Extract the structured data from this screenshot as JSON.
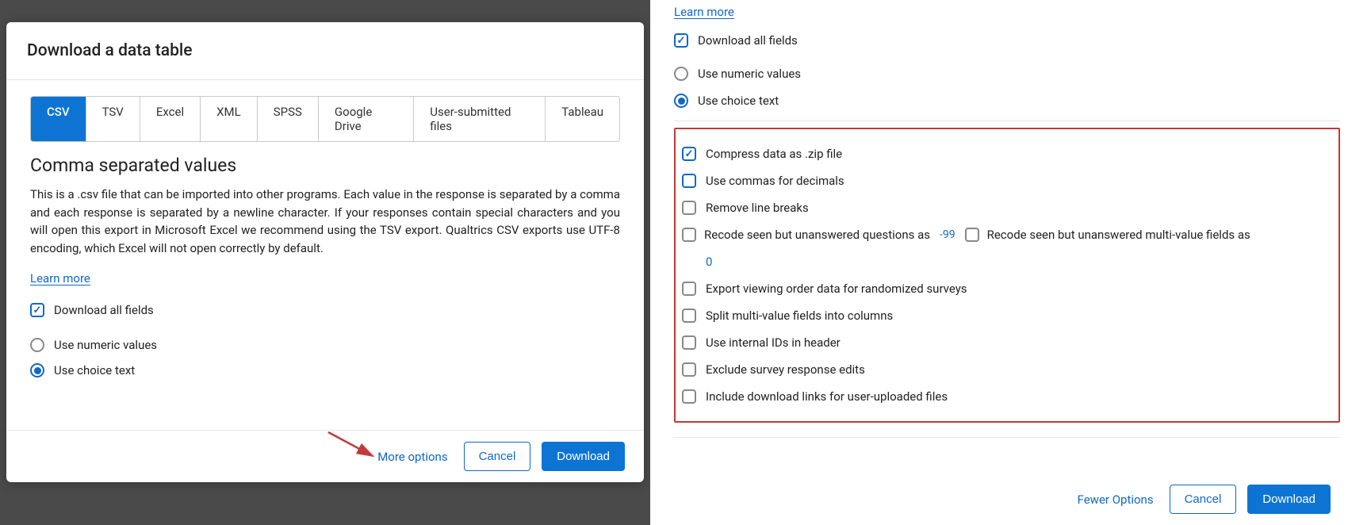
{
  "dialog": {
    "title": "Download a data table",
    "tabs": [
      "CSV",
      "TSV",
      "Excel",
      "XML",
      "SPSS",
      "Google Drive",
      "User-submitted files",
      "Tableau"
    ],
    "active_tab_index": 0,
    "subtitle": "Comma separated values",
    "description": "This is a .csv file that can be imported into other programs. Each value in the response is separated by a comma and each response is separated by a newline character. If your responses contain special characters and you will open this export in Microsoft Excel we recommend using the TSV export. Qualtrics CSV exports use UTF-8 encoding, which Excel will not open correctly by default.",
    "learn_more": "Learn more",
    "download_all_fields": "Download all fields",
    "use_numeric": "Use numeric values",
    "use_choice_text": "Use choice text",
    "footer": {
      "more_options": "More options",
      "cancel": "Cancel",
      "download": "Download"
    }
  },
  "right": {
    "learn_more": "Learn more",
    "download_all_fields": "Download all fields",
    "use_numeric": "Use numeric values",
    "use_choice_text": "Use choice text",
    "options": {
      "compress": "Compress data as .zip file",
      "commas_decimals": "Use commas for decimals",
      "remove_line_breaks": "Remove line breaks",
      "recode_q": "Recode seen but unanswered questions as",
      "recode_q_val": "-99",
      "recode_mv": "Recode seen but unanswered multi-value fields as",
      "recode_mv_val": "0",
      "export_order": "Export viewing order data for randomized surveys",
      "split_mv": "Split multi-value fields into columns",
      "internal_ids": "Use internal IDs in header",
      "exclude_edits": "Exclude survey response edits",
      "include_links": "Include download links for user-uploaded files"
    },
    "footer": {
      "fewer_options": "Fewer Options",
      "cancel": "Cancel",
      "download": "Download"
    }
  }
}
